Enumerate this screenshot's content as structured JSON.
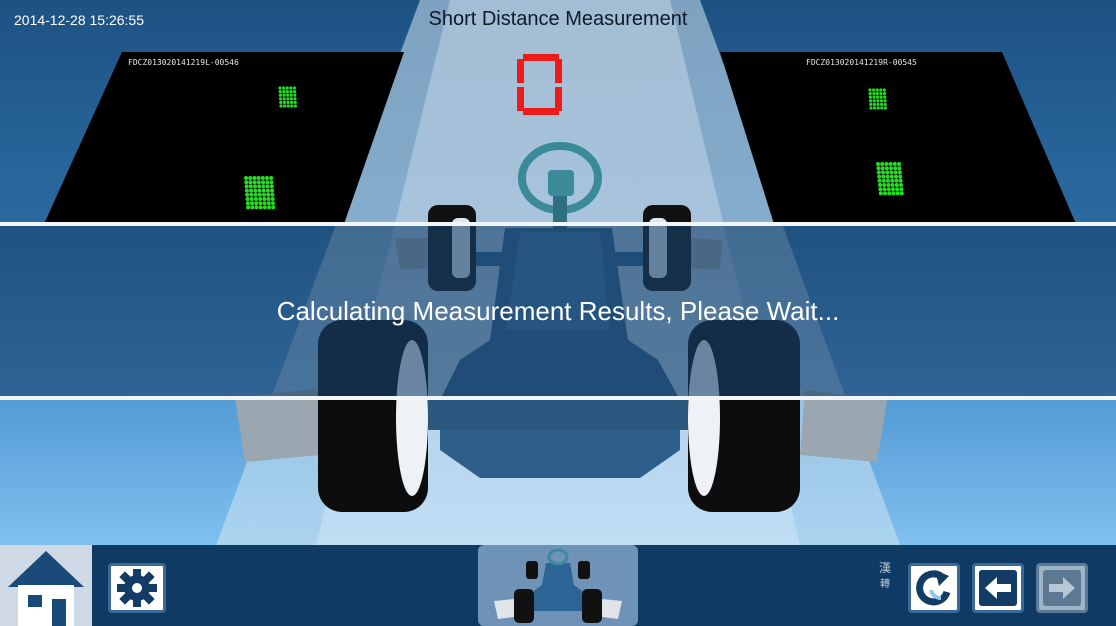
{
  "header": {
    "datetime": "2014-12-28 15:26:55",
    "title": "Short Distance Measurement"
  },
  "countdown": {
    "digit": "0",
    "color": "#ee1b1b"
  },
  "cameras": {
    "left": {
      "serial": "FDCZ013020141219L-00546"
    },
    "right": {
      "serial": "FDCZ013020141219R-00545"
    }
  },
  "target_dot_color": "#22dd22",
  "status": {
    "message": "Calculating Measurement Results, Please Wait..."
  },
  "toolbar": {
    "lang_chars": [
      "漢",
      "轉"
    ],
    "icons": {
      "home": "home-icon",
      "settings": "gear-icon",
      "thumbnail": "vehicle-thumbnail",
      "refresh": "refresh-icon",
      "back": "arrow-left-icon",
      "next": "arrow-right-icon"
    }
  },
  "colors": {
    "accent": "#0e3a63",
    "overlay": "#18426c",
    "digit_red": "#ee1b1b"
  }
}
